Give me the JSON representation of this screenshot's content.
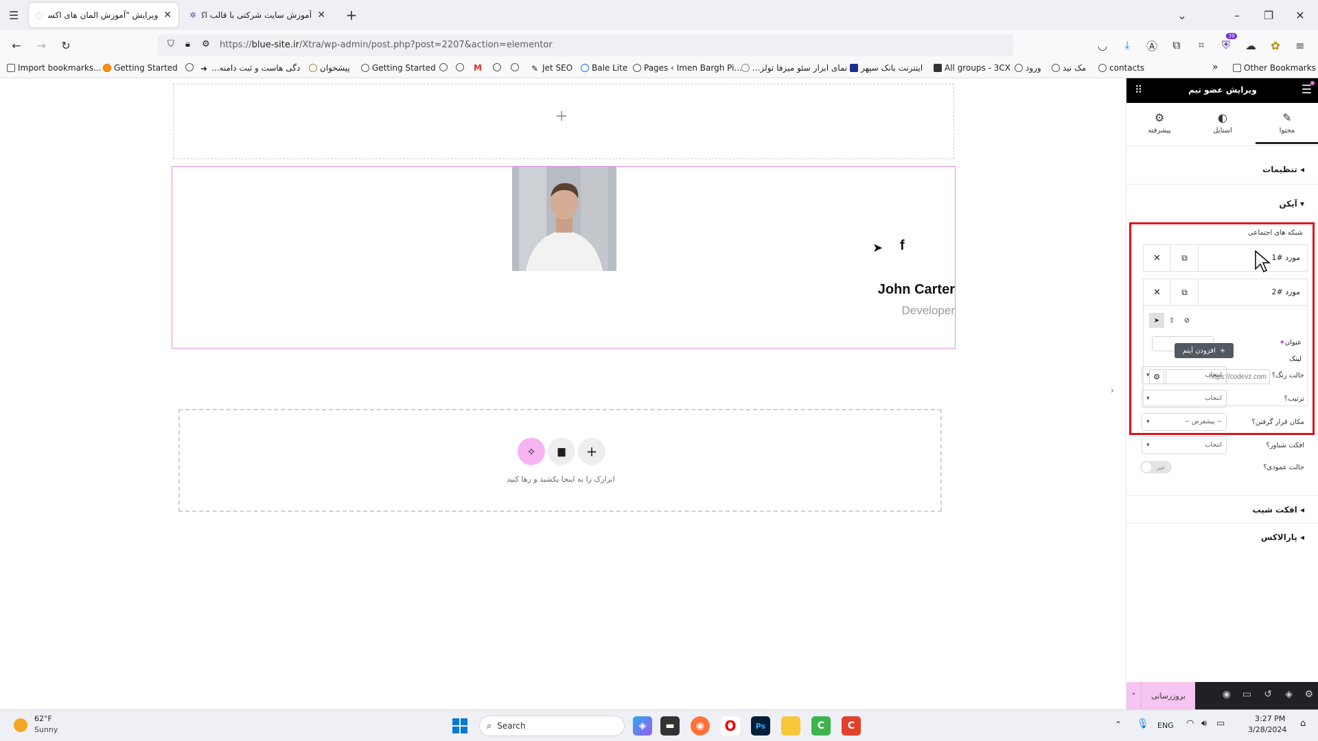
{
  "browser": {
    "tabs": [
      {
        "title": "ویرایش \"آموزش المان های اکسترا – ...",
        "active": true
      },
      {
        "title": "آموزش سایت شرکتی با قالب اکس...",
        "active": false
      }
    ],
    "new_tab": "+",
    "url_prefix": "https://",
    "url_host": "blue-site.ir",
    "url_path": "/Xtra/wp-admin/post.php?post=2207&action=elementor",
    "downloads_badge": "39",
    "bookmarks": [
      "Import bookmarks...",
      "Getting Started",
      "...دگی هاست و ثبت دامنه",
      "پیشخوان",
      "Getting Started",
      "Jet SEO",
      "Bale Lite",
      "Pages ‹ Imen Bargh Pi...",
      "...نمای ابزار سئو میزفا تولز",
      "اینترنت بانک سپهر",
      "All groups - 3CX",
      "ورود",
      "مک نید",
      "contacts"
    ],
    "other_bookmarks": "Other Bookmarks",
    "more_bookmarks": "»"
  },
  "canvas": {
    "add_section_plus": "+",
    "team_member": {
      "name": "John Carter",
      "role": "Developer",
      "social_icons": [
        "telegram-icon",
        "facebook-icon"
      ]
    },
    "drop_zone": {
      "hint": "ابزارک را به اینجا بکشید و رها کنید",
      "buttons": [
        "ai-sparkle-icon",
        "folder-icon",
        "plus-icon"
      ]
    }
  },
  "panel": {
    "header_title": "ویرایش عضو تیم",
    "tabs": [
      {
        "label": "محتوا",
        "icon": "pencil-icon",
        "active": true
      },
      {
        "label": "استایل",
        "icon": "contrast-icon",
        "active": false
      },
      {
        "label": "پیشرفته",
        "icon": "gear-icon",
        "active": false
      }
    ],
    "sections": {
      "settings": "تنظیمات",
      "icon": "آیکن",
      "tilt": "افکت شیب",
      "parallax": "پارالاکس"
    },
    "social_networks_label": "شبکه های اجتماعی",
    "repeater_items": [
      {
        "label": "مورد #1"
      },
      {
        "label": "مورد #2"
      }
    ],
    "title_label": "عنوان",
    "link_label": "لینک",
    "link_placeholder": "https://codevz.com",
    "add_item_label": "افزودن آیتم",
    "controls": [
      {
        "label": "حالت رنگ؟",
        "value": "انتخاب"
      },
      {
        "label": "ترتیب؟",
        "value": "انتخاب"
      },
      {
        "label": "مکان قرار گرفتن؟",
        "value": "~ پیشفرض ~"
      },
      {
        "label": "افکت شناور؟",
        "value": "انتخاب"
      }
    ],
    "vertical_mode_label": "حالت عمودی؟",
    "vertical_mode_value": "خیر",
    "update_button": "بروزرسانی",
    "highlight_color": "#e0101c"
  },
  "taskbar": {
    "weather_temp": "62°F",
    "weather_desc": "Sunny",
    "search_placeholder": "Search",
    "language": "ENG",
    "time": "3:27 PM",
    "date": "3/28/2024"
  }
}
